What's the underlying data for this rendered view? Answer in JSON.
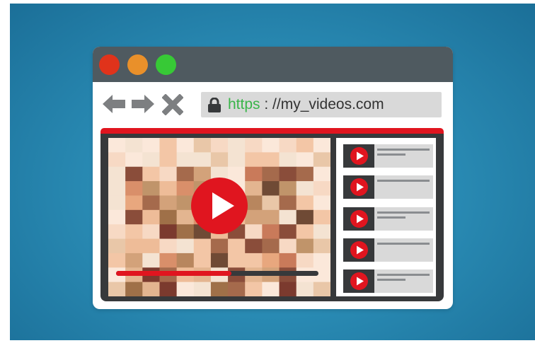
{
  "browser": {
    "window_controls": [
      {
        "name": "close",
        "color": "#e0331b"
      },
      {
        "name": "minimize",
        "color": "#e9902a"
      },
      {
        "name": "maximize",
        "color": "#37c936"
      }
    ],
    "nav_icons": [
      "back-arrow-icon",
      "forward-arrow-icon",
      "close-x-icon"
    ],
    "address": {
      "lock_icon": "lock-icon",
      "scheme": "https",
      "rest": " : //my_videos.com"
    }
  },
  "player": {
    "play_icon": "play-icon",
    "progress": 0.57,
    "colors": {
      "accent": "#e0151f",
      "frame": "#37393b"
    }
  },
  "sidebar": {
    "items": [
      {
        "icon": "play-icon"
      },
      {
        "icon": "play-icon"
      },
      {
        "icon": "play-icon"
      },
      {
        "icon": "play-icon"
      },
      {
        "icon": "play-icon"
      }
    ]
  }
}
